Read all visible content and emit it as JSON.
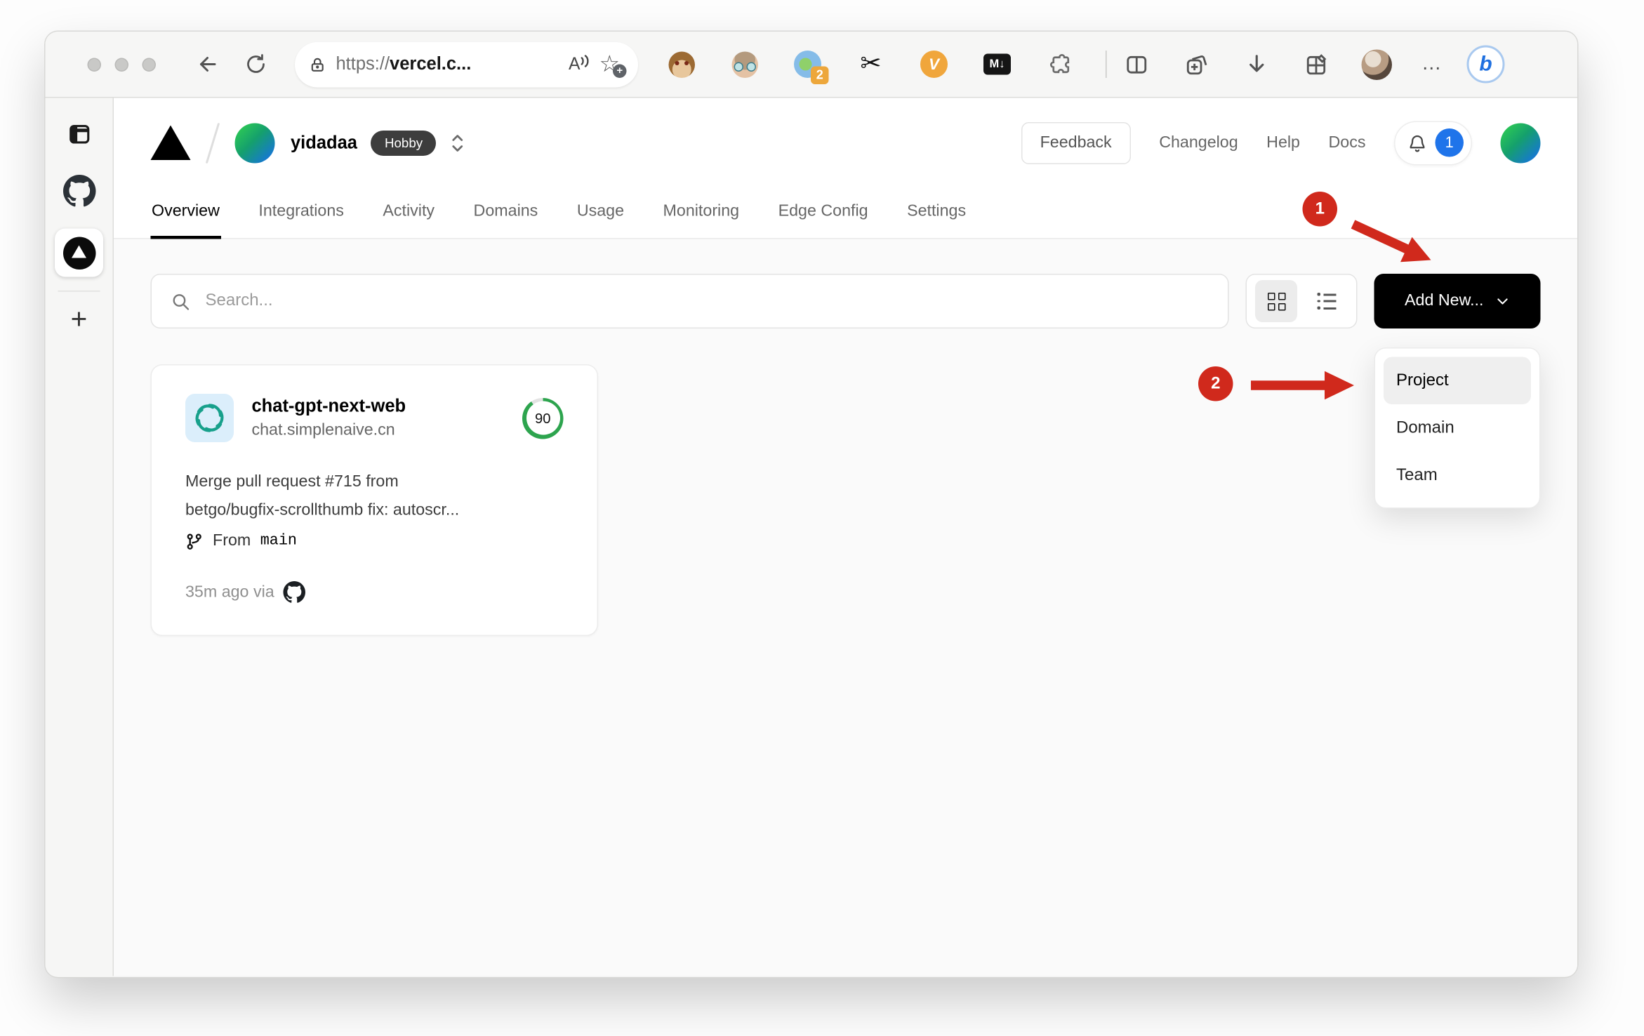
{
  "browser": {
    "url": {
      "scheme": "https://",
      "host": "vercel.c..."
    },
    "read_aloud_label": "A",
    "extensions": {
      "badge_count": "2",
      "v_label": "V",
      "markdown_label": "M↓"
    },
    "more_label": "…",
    "bing_label": "b",
    "new_tab_label": "+"
  },
  "vercel": {
    "header": {
      "team_name": "yidadaa",
      "plan_badge": "Hobby",
      "feedback_label": "Feedback",
      "links": [
        "Changelog",
        "Help",
        "Docs"
      ],
      "notification_count": "1"
    },
    "tabs": [
      {
        "label": "Overview",
        "active": true
      },
      {
        "label": "Integrations"
      },
      {
        "label": "Activity"
      },
      {
        "label": "Domains"
      },
      {
        "label": "Usage"
      },
      {
        "label": "Monitoring"
      },
      {
        "label": "Edge Config"
      },
      {
        "label": "Settings"
      }
    ],
    "toolbar": {
      "search_placeholder": "Search...",
      "add_new_label": "Add New..."
    },
    "dropdown": {
      "items": [
        {
          "label": "Project",
          "highlighted": true
        },
        {
          "label": "Domain"
        },
        {
          "label": "Team"
        }
      ]
    },
    "project_card": {
      "name": "chat-gpt-next-web",
      "domain": "chat.simplenaive.cn",
      "score": "90",
      "commit_line1": "Merge pull request #715 from",
      "commit_line2": "betgo/bugfix-scrollthumb fix: autoscr...",
      "branch_prefix": "From",
      "branch_name": "main",
      "deployed_meta": "35m ago via"
    }
  },
  "annotations": {
    "step1": "1",
    "step2": "2"
  },
  "colors": {
    "accent_black": "#000000",
    "annotation_red": "#d0291c",
    "score_green": "#2da44e",
    "badge_blue": "#1f74ea"
  }
}
